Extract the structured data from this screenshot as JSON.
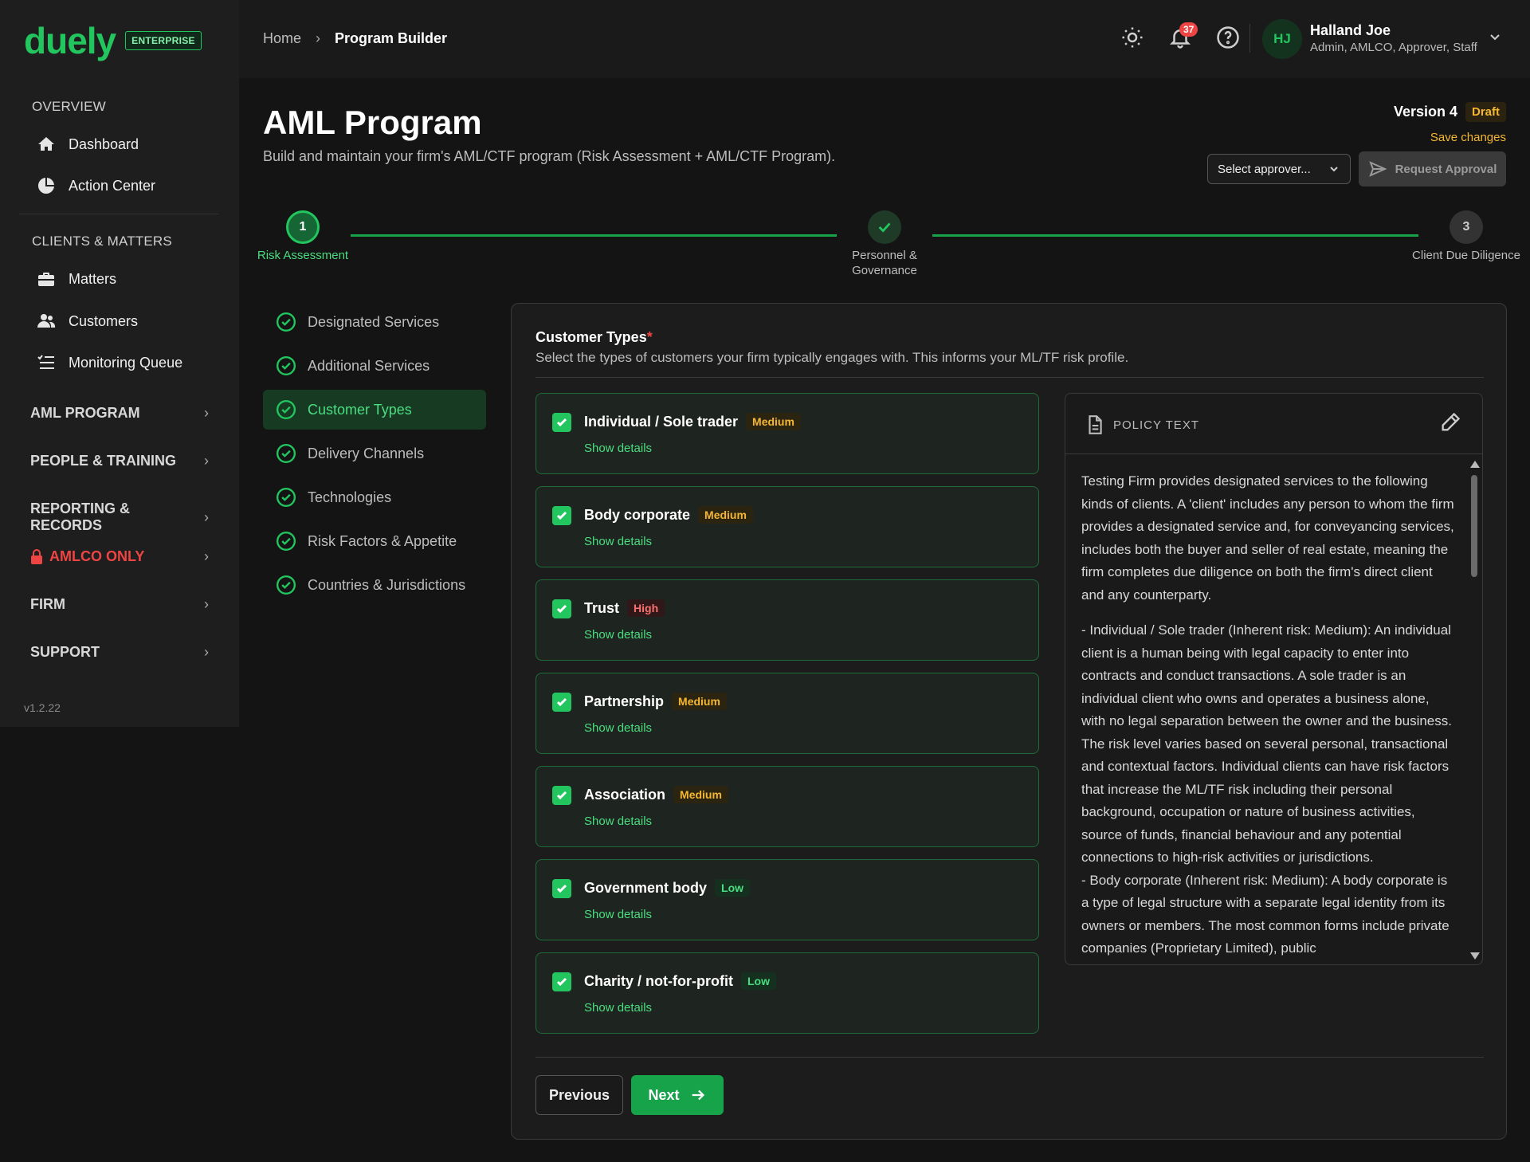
{
  "brand": {
    "logo": "duely",
    "badge": "ENTERPRISE"
  },
  "sidebar": {
    "overview_label": "OVERVIEW",
    "overview_items": [
      {
        "label": "Dashboard",
        "icon": "home-icon"
      },
      {
        "label": "Action Center",
        "icon": "pie-chart-icon"
      }
    ],
    "clients_label": "CLIENTS & MATTERS",
    "clients_items": [
      {
        "label": "Matters",
        "icon": "briefcase-icon"
      },
      {
        "label": "Customers",
        "icon": "users-icon"
      },
      {
        "label": "Monitoring Queue",
        "icon": "list-check-icon"
      }
    ],
    "groups": [
      {
        "label": "AML PROGRAM"
      },
      {
        "label": "PEOPLE & TRAINING"
      },
      {
        "label": "REPORTING & RECORDS"
      },
      {
        "label": "AMLCO ONLY"
      },
      {
        "label": "FIRM"
      },
      {
        "label": "SUPPORT"
      }
    ],
    "version": "v1.2.22"
  },
  "header": {
    "breadcrumb_home": "Home",
    "breadcrumb_separator": "›",
    "breadcrumb_current": "Program Builder",
    "notification_count": "37",
    "user": {
      "initials": "HJ",
      "name": "Halland Joe",
      "roles": "Admin, AMLCO, Approver, Staff"
    }
  },
  "page": {
    "title": "AML Program",
    "subtitle": "Build and maintain your firm's AML/CTF program (Risk Assessment + AML/CTF Program).",
    "version_label": "Version 4",
    "status": "Draft",
    "save_changes": "Save changes",
    "approver_placeholder": "Select approver...",
    "request_approval": "Request Approval"
  },
  "stepper": [
    {
      "number": "1",
      "label": "Risk Assessment",
      "state": "active"
    },
    {
      "number": "✓",
      "label": "Personnel & Governance",
      "state": "done"
    },
    {
      "number": "3",
      "label": "Client Due Diligence",
      "state": "todo"
    }
  ],
  "subnav": [
    {
      "label": "Designated Services"
    },
    {
      "label": "Additional Services"
    },
    {
      "label": "Customer Types",
      "active": true
    },
    {
      "label": "Delivery Channels"
    },
    {
      "label": "Technologies"
    },
    {
      "label": "Risk Factors & Appetite"
    },
    {
      "label": "Countries & Jurisdictions"
    }
  ],
  "section": {
    "title": "Customer Types",
    "required_mark": "*",
    "description": "Select the types of customers your firm typically engages with. This informs your ML/TF risk profile."
  },
  "customer_types": [
    {
      "name": "Individual / Sole trader",
      "risk": "Medium",
      "details": "Show details"
    },
    {
      "name": "Body corporate",
      "risk": "Medium",
      "details": "Show details"
    },
    {
      "name": "Trust",
      "risk": "High",
      "details": "Show details"
    },
    {
      "name": "Partnership",
      "risk": "Medium",
      "details": "Show details"
    },
    {
      "name": "Association",
      "risk": "Medium",
      "details": "Show details"
    },
    {
      "name": "Government body",
      "risk": "Low",
      "details": "Show details"
    },
    {
      "name": "Charity / not-for-profit",
      "risk": "Low",
      "details": "Show details"
    }
  ],
  "policy": {
    "title": "POLICY TEXT",
    "paragraph_1": "Testing Firm provides designated services to the following kinds of clients. A 'client' includes any person to whom the firm provides a designated service and, for conveyancing services, includes both the buyer and seller of real estate, meaning the firm completes due diligence on both the firm's direct client and any counterparty.",
    "paragraph_2": "- Individual / Sole trader (Inherent risk: Medium): An individual client is a human being with legal capacity to enter into contracts and conduct transactions. A sole trader is an individual client who owns and operates a business alone, with no legal separation between the owner and the business. The risk level varies based on several personal, transactional and contextual factors. Individual clients can have risk factors that increase the ML/TF risk including their personal background, occupation or nature of business activities, source of funds, financial behaviour and any potential connections to high-risk activities or jurisdictions.",
    "paragraph_3": "- Body corporate (Inherent risk: Medium): A body corporate is a type of legal structure with a separate legal identity from its owners or members. The most common forms include private companies (Proprietary Limited), public"
  },
  "footer": {
    "previous": "Previous",
    "next": "Next"
  },
  "colors": {
    "accent": "#22c55e",
    "draft": "#f5b731",
    "danger": "#ef4444"
  }
}
